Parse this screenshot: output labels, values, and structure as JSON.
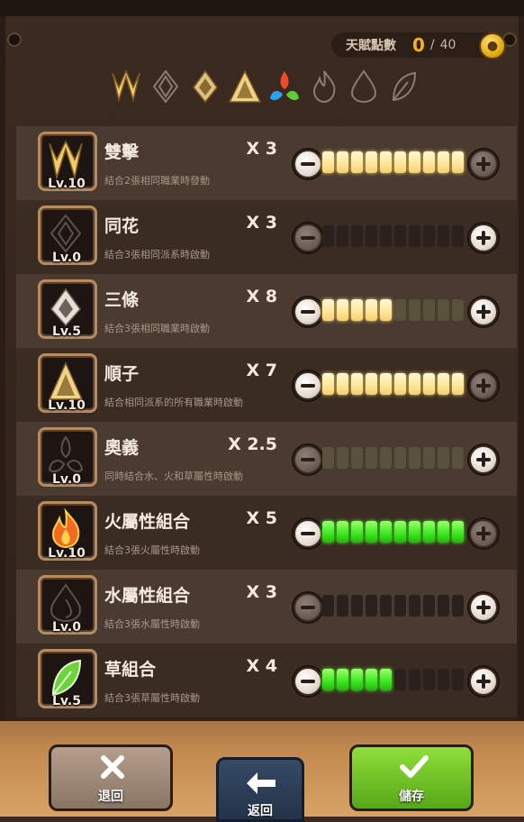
{
  "header": {
    "talent_label": "天賦點數",
    "talent_value": "0",
    "talent_sep": "/",
    "talent_max": "40",
    "coin_icon": "coin-icon"
  },
  "category_icons": [
    "double-triangle-icon",
    "diamond-rune-icon",
    "flower-rune-icon",
    "pyramid-rune-icon",
    "element-icon",
    "fire-icon",
    "water-drop-icon",
    "leaf-icon"
  ],
  "rows": [
    {
      "name": "雙擊",
      "desc": "結合2張相同職業時發動",
      "mult": "X 3",
      "lv": "Lv.10",
      "filled": 10,
      "fill_color": "yellow",
      "total": 10,
      "minus_active": true,
      "plus_active": false,
      "icon": "double-triangle-icon"
    },
    {
      "name": "同花",
      "desc": "結合3張相同派系時啟動",
      "mult": "X 3",
      "lv": "Lv.0",
      "filled": 0,
      "fill_color": "yellow",
      "total": 10,
      "minus_active": false,
      "plus_active": true,
      "icon": "diamond-rune-icon"
    },
    {
      "name": "三條",
      "desc": "結合3張相同職業時啟動",
      "mult": "X 8",
      "lv": "Lv.5",
      "filled": 5,
      "fill_color": "yellow",
      "faded": 5,
      "total": 10,
      "minus_active": true,
      "plus_active": true,
      "icon": "flower-rune-icon"
    },
    {
      "name": "順子",
      "desc": "結合相同派系的所有職業時啟動",
      "mult": "X 7",
      "lv": "Lv.10",
      "filled": 10,
      "fill_color": "yellow",
      "total": 10,
      "minus_active": true,
      "plus_active": false,
      "icon": "pyramid-rune-icon"
    },
    {
      "name": "奧義",
      "desc": "同時結合水、火和草屬性時啟動",
      "mult": "X 2.5",
      "lv": "Lv.0",
      "filled": 0,
      "faded": 10,
      "fill_color": "yellow",
      "total": 10,
      "minus_active": false,
      "plus_active": true,
      "icon": "element-icon"
    },
    {
      "name": "火屬性組合",
      "desc": "結合3張火屬性時啟動",
      "mult": "X 5",
      "lv": "Lv.10",
      "filled": 10,
      "fill_color": "green",
      "total": 10,
      "minus_active": true,
      "plus_active": false,
      "icon": "fire-icon"
    },
    {
      "name": "水屬性組合",
      "desc": "結合3張水屬性時啟動",
      "mult": "X 3",
      "lv": "Lv.0",
      "filled": 0,
      "fill_color": "green",
      "total": 10,
      "minus_active": false,
      "plus_active": true,
      "icon": "water-drop-icon"
    },
    {
      "name": "草組合",
      "desc": "結合3張草屬性時啟動",
      "mult": "X 4",
      "lv": "Lv.5",
      "filled": 5,
      "fill_color": "green",
      "total": 10,
      "minus_active": true,
      "plus_active": true,
      "icon": "leaf-icon"
    }
  ],
  "buttons": {
    "reset": {
      "label": "退回",
      "icon": "close-icon"
    },
    "back": {
      "label": "返回",
      "icon": "back-arrow-icon"
    },
    "save": {
      "label": "儲存",
      "icon": "check-icon"
    }
  },
  "colors": {
    "accent_gold": "#f2b21b",
    "yellow_cell": "#ffe597",
    "green_cell": "#3be61f",
    "save_button": "#6cc020"
  }
}
